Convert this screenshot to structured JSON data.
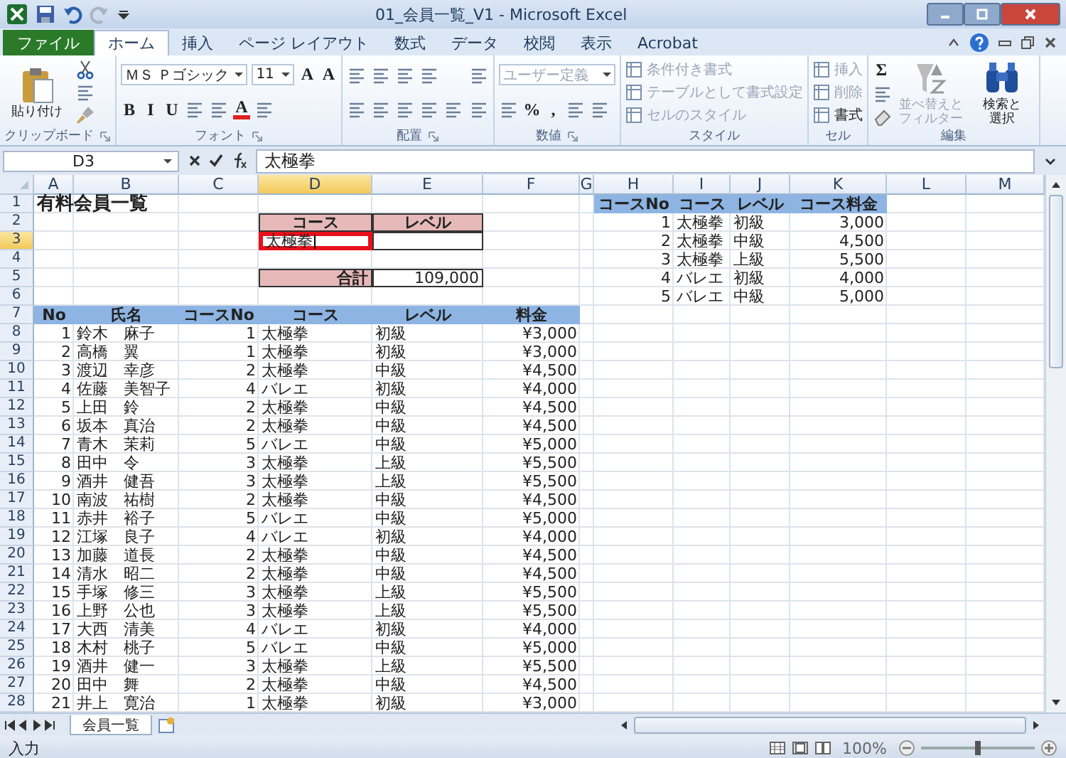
{
  "window": {
    "title": "01_会員一覧_V1 - Microsoft Excel"
  },
  "tabs": [
    {
      "label": "ファイル",
      "kind": "file",
      "selected": false
    },
    {
      "label": "ホーム",
      "kind": "tab",
      "selected": true
    },
    {
      "label": "挿入",
      "kind": "tab",
      "selected": false
    },
    {
      "label": "ページ レイアウト",
      "kind": "tab",
      "selected": false
    },
    {
      "label": "数式",
      "kind": "tab",
      "selected": false
    },
    {
      "label": "データ",
      "kind": "tab",
      "selected": false
    },
    {
      "label": "校閲",
      "kind": "tab",
      "selected": false
    },
    {
      "label": "表示",
      "kind": "tab",
      "selected": false
    },
    {
      "label": "Acrobat",
      "kind": "tab",
      "selected": false
    }
  ],
  "ribbon": {
    "groups": [
      {
        "label": "クリップボード",
        "launcher": true,
        "columns": [
          [
            [
              {
                "kind": "paste",
                "lines": [
                  "貼り付け"
                ],
                "disabled": false
              }
            ]
          ],
          [
            [
              {
                "kind": "scissors"
              }
            ],
            [
              {
                "kind": "tool"
              }
            ],
            [
              {
                "kind": "brush"
              }
            ]
          ]
        ]
      },
      {
        "label": "フォント",
        "launcher": true,
        "columns": [
          [
            [
              {
                "kind": "combo",
                "label": "ＭＳ Ｐゴシック",
                "disabled": false
              },
              {
                "kind": "combo",
                "label": "11",
                "disabled": false
              },
              {
                "kind": "glyph",
                "label": "A"
              },
              {
                "kind": "glyph",
                "label": "A"
              }
            ],
            [
              {
                "kind": "glyph",
                "label": "B"
              },
              {
                "kind": "glyph",
                "label": "I"
              },
              {
                "kind": "glyph",
                "label": "U"
              },
              {
                "kind": "tool"
              },
              {
                "kind": "tool"
              },
              {
                "kind": "fontcolor",
                "label": "A"
              },
              {
                "kind": "tool"
              }
            ]
          ]
        ]
      },
      {
        "label": "配置",
        "launcher": true,
        "columns": [
          [
            [
              {
                "kind": "tool"
              },
              {
                "kind": "tool"
              },
              {
                "kind": "tool"
              },
              {
                "kind": "tool"
              }
            ],
            [
              {
                "kind": "tool"
              },
              {
                "kind": "tool"
              },
              {
                "kind": "tool"
              },
              {
                "kind": "tool"
              },
              {
                "kind": "tool"
              }
            ]
          ],
          [
            [
              {
                "kind": "tool"
              }
            ],
            [
              {
                "kind": "tool"
              }
            ]
          ]
        ]
      },
      {
        "label": "数値",
        "launcher": true,
        "columns": [
          [
            [
              {
                "kind": "combo",
                "label": "ユーザー定義",
                "disabled": true
              }
            ],
            [
              {
                "kind": "tool"
              },
              {
                "kind": "glyph",
                "label": "%"
              },
              {
                "kind": "glyph",
                "label": ","
              },
              {
                "kind": "tool"
              },
              {
                "kind": "tool"
              }
            ]
          ]
        ]
      },
      {
        "label": "スタイル",
        "launcher": false,
        "columns": [
          [
            [
              {
                "kind": "small",
                "label": "条件付き書式",
                "disabled": true
              }
            ],
            [
              {
                "kind": "small",
                "label": "テーブルとして書式設定",
                "disabled": true
              }
            ],
            [
              {
                "kind": "small",
                "label": "セルのスタイル",
                "disabled": true
              }
            ]
          ]
        ]
      },
      {
        "label": "セル",
        "launcher": false,
        "columns": [
          [
            [
              {
                "kind": "small",
                "label": "挿入",
                "disabled": true
              }
            ],
            [
              {
                "kind": "small",
                "label": "削除",
                "disabled": true
              }
            ],
            [
              {
                "kind": "small",
                "label": "書式",
                "disabled": false
              }
            ]
          ]
        ]
      },
      {
        "label": "編集",
        "launcher": false,
        "columns": [
          [
            [
              {
                "kind": "glyph",
                "label": "Σ"
              }
            ],
            [
              {
                "kind": "tool"
              }
            ],
            [
              {
                "kind": "eraser"
              }
            ]
          ],
          [
            [
              {
                "kind": "sort",
                "lines": [
                  "並べ替えと",
                  "フィルター"
                ],
                "disabled": true
              }
            ]
          ],
          [
            [
              {
                "kind": "find",
                "lines": [
                  "検索と",
                  "選択"
                ],
                "disabled": false
              }
            ]
          ]
        ]
      }
    ]
  },
  "formula_bar": {
    "name_box": "D3",
    "value": "太極拳"
  },
  "sheet": {
    "columns": [
      {
        "label": "A",
        "selected": false
      },
      {
        "label": "B",
        "selected": false
      },
      {
        "label": "C",
        "selected": false
      },
      {
        "label": "D",
        "selected": true
      },
      {
        "label": "E",
        "selected": false
      },
      {
        "label": "F",
        "selected": false
      },
      {
        "label": "G",
        "selected": false
      },
      {
        "label": "H",
        "selected": false
      },
      {
        "label": "I",
        "selected": false
      },
      {
        "label": "J",
        "selected": false
      },
      {
        "label": "K",
        "selected": false
      },
      {
        "label": "L",
        "selected": false
      },
      {
        "label": "M",
        "selected": false
      }
    ],
    "rows": [
      {
        "label": "1",
        "selected": false
      },
      {
        "label": "2",
        "selected": false
      },
      {
        "label": "3",
        "selected": true
      },
      {
        "label": "4",
        "selected": false
      },
      {
        "label": "5",
        "selected": false
      },
      {
        "label": "6",
        "selected": false
      },
      {
        "label": "7",
        "selected": false
      },
      {
        "label": "8",
        "selected": false
      },
      {
        "label": "9",
        "selected": false
      },
      {
        "label": "10",
        "selected": false
      },
      {
        "label": "11",
        "selected": false
      },
      {
        "label": "12",
        "selected": false
      },
      {
        "label": "13",
        "selected": false
      },
      {
        "label": "14",
        "selected": false
      },
      {
        "label": "15",
        "selected": false
      },
      {
        "label": "16",
        "selected": false
      },
      {
        "label": "17",
        "selected": false
      },
      {
        "label": "18",
        "selected": false
      },
      {
        "label": "19",
        "selected": false
      },
      {
        "label": "20",
        "selected": false
      },
      {
        "label": "21",
        "selected": false
      },
      {
        "label": "22",
        "selected": false
      },
      {
        "label": "23",
        "selected": false
      },
      {
        "label": "24",
        "selected": false
      },
      {
        "label": "25",
        "selected": false
      },
      {
        "label": "26",
        "selected": false
      },
      {
        "label": "27",
        "selected": false
      },
      {
        "label": "28",
        "selected": false
      }
    ],
    "title": "有料会員一覧",
    "search": {
      "headers": [
        "コース",
        "レベル"
      ],
      "value": "太極拳",
      "highlighted": true
    },
    "total": {
      "label": "合計",
      "value": "109,000"
    },
    "members": {
      "columns": [
        {
          "label": "No",
          "kind": "number"
        },
        {
          "label": "氏名",
          "kind": "text"
        },
        {
          "label": "コースNo",
          "kind": "number"
        },
        {
          "label": "コース",
          "kind": "text"
        },
        {
          "label": "レベル",
          "kind": "text"
        },
        {
          "label": "料金",
          "kind": "number"
        }
      ],
      "rows": [
        [
          "1",
          "鈴木　麻子",
          "1",
          "太極拳",
          "初級",
          "¥3,000"
        ],
        [
          "2",
          "高橋　翼",
          "1",
          "太極拳",
          "初級",
          "¥3,000"
        ],
        [
          "3",
          "渡辺　幸彦",
          "2",
          "太極拳",
          "中級",
          "¥4,500"
        ],
        [
          "4",
          "佐藤　美智子",
          "4",
          "バレエ",
          "初級",
          "¥4,000"
        ],
        [
          "5",
          "上田　鈴",
          "2",
          "太極拳",
          "中級",
          "¥4,500"
        ],
        [
          "6",
          "坂本　真治",
          "2",
          "太極拳",
          "中級",
          "¥4,500"
        ],
        [
          "7",
          "青木　茉莉",
          "5",
          "バレエ",
          "中級",
          "¥5,000"
        ],
        [
          "8",
          "田中　令",
          "3",
          "太極拳",
          "上級",
          "¥5,500"
        ],
        [
          "9",
          "酒井　健吾",
          "3",
          "太極拳",
          "上級",
          "¥5,500"
        ],
        [
          "10",
          "南波　祐樹",
          "2",
          "太極拳",
          "中級",
          "¥4,500"
        ],
        [
          "11",
          "赤井　裕子",
          "5",
          "バレエ",
          "中級",
          "¥5,000"
        ],
        [
          "12",
          "江塚　良子",
          "4",
          "バレエ",
          "初級",
          "¥4,000"
        ],
        [
          "13",
          "加藤　道長",
          "2",
          "太極拳",
          "中級",
          "¥4,500"
        ],
        [
          "14",
          "清水　昭二",
          "2",
          "太極拳",
          "中級",
          "¥4,500"
        ],
        [
          "15",
          "手塚　修三",
          "3",
          "太極拳",
          "上級",
          "¥5,500"
        ],
        [
          "16",
          "上野　公也",
          "3",
          "太極拳",
          "上級",
          "¥5,500"
        ],
        [
          "17",
          "大西　清美",
          "4",
          "バレエ",
          "初級",
          "¥4,000"
        ],
        [
          "18",
          "木村　桃子",
          "5",
          "バレエ",
          "中級",
          "¥5,000"
        ],
        [
          "19",
          "酒井　健一",
          "3",
          "太極拳",
          "上級",
          "¥5,500"
        ],
        [
          "20",
          "田中　舞",
          "2",
          "太極拳",
          "中級",
          "¥4,500"
        ],
        [
          "21",
          "井上　寛治",
          "1",
          "太極拳",
          "初級",
          "¥3,000"
        ]
      ]
    },
    "courses": {
      "columns": [
        {
          "label": "コースNo",
          "kind": "number"
        },
        {
          "label": "コース",
          "kind": "text"
        },
        {
          "label": "レベル",
          "kind": "text"
        },
        {
          "label": "コース料金",
          "kind": "number"
        }
      ],
      "rows": [
        [
          "1",
          "太極拳",
          "初級",
          "3,000"
        ],
        [
          "2",
          "太極拳",
          "中級",
          "4,500"
        ],
        [
          "3",
          "太極拳",
          "上級",
          "5,500"
        ],
        [
          "4",
          "バレエ",
          "初級",
          "4,000"
        ],
        [
          "5",
          "バレエ",
          "中級",
          "5,000"
        ]
      ]
    }
  },
  "sheet_tabs": [
    {
      "label": "会員一覧",
      "selected": true
    }
  ],
  "status_bar": {
    "mode": "入力",
    "zoom": "100%",
    "zoom_slider": {
      "level": 0.5
    }
  }
}
